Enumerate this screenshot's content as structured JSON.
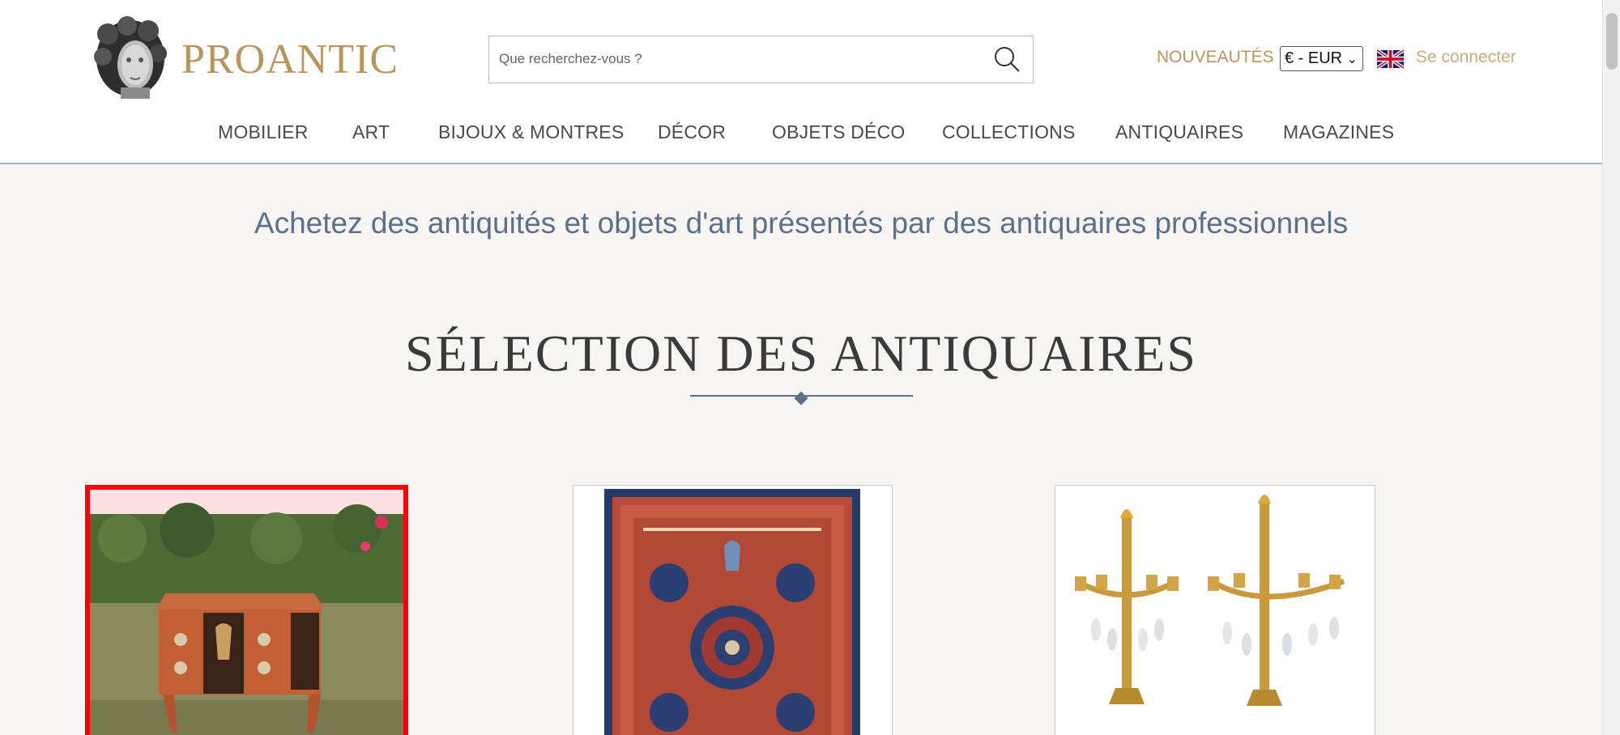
{
  "brand": {
    "name": "PROANTIC"
  },
  "search": {
    "placeholder": "Que recherchez-vous ?"
  },
  "topbar": {
    "new_label": "NOUVEAUTÉS",
    "currency": "€ - EUR",
    "language_flag": "uk-flag-icon",
    "login_label": "Se connecter"
  },
  "nav": {
    "items": [
      {
        "label": "MOBILIER"
      },
      {
        "label": "ART"
      },
      {
        "label": "BIJOUX & MONTRES"
      },
      {
        "label": "DÉCOR"
      },
      {
        "label": "OBJETS DÉCO"
      },
      {
        "label": "COLLECTIONS"
      },
      {
        "label": "ANTIQUAIRES"
      },
      {
        "label": "MAGAZINES"
      }
    ]
  },
  "main": {
    "tagline": "Achetez des antiquités et objets d'art présentés par des antiquaires professionnels",
    "section_title": "SÉLECTION DES ANTIQUAIRES",
    "products": [
      {
        "image": "inlaid-commode-photo"
      },
      {
        "image": "persian-rug-photo"
      },
      {
        "image": "gilt-candelabra-photo"
      }
    ]
  },
  "colors": {
    "brand_gold": "#b8955a",
    "nav_text": "#4a4a4a",
    "tagline_blue": "#5d7089",
    "selection_red": "#ff0000",
    "page_bg": "#f6f5f3"
  }
}
